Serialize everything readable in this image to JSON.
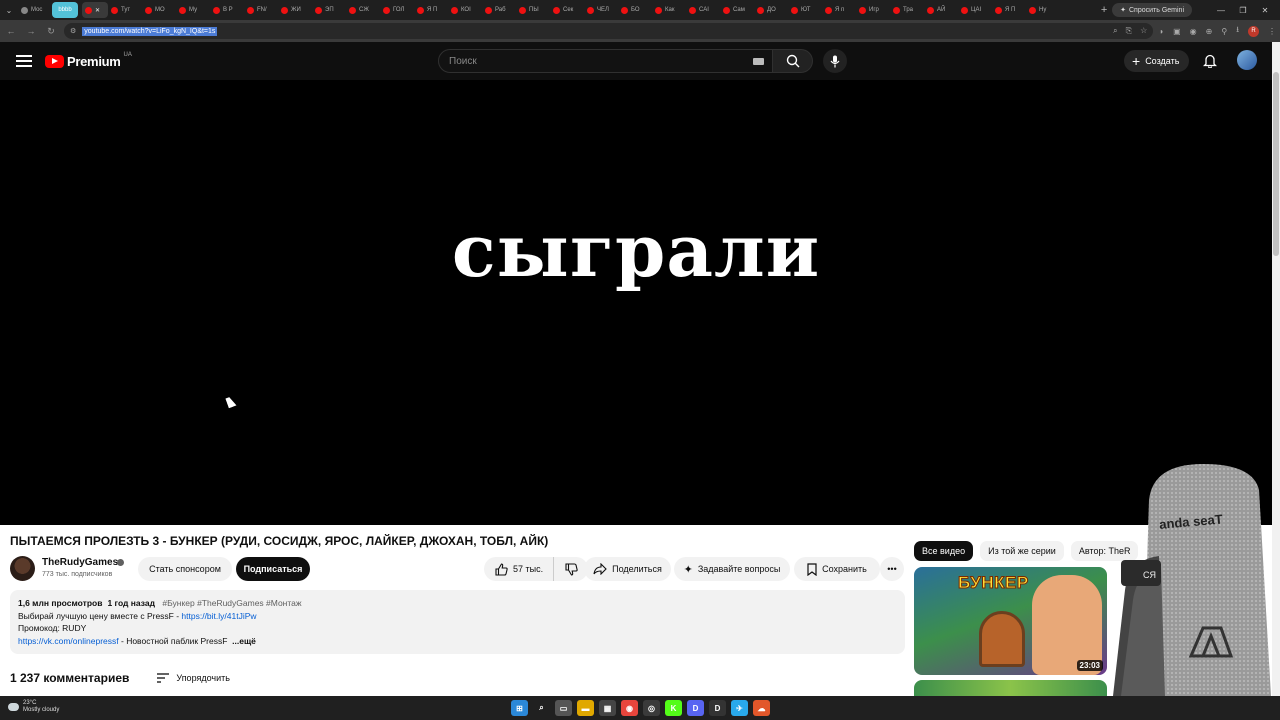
{
  "browser": {
    "tab_menu_icon": "chevron-down-icon",
    "tabs": [
      {
        "label": "Мос",
        "fav": "g"
      },
      {
        "label": "bbbb",
        "style": "hl"
      },
      {
        "label": "",
        "style": "active"
      },
      {
        "label": "Тут",
        "fav": "r"
      },
      {
        "label": "МО",
        "fav": "r"
      },
      {
        "label": "Му",
        "fav": "r"
      },
      {
        "label": "В Р",
        "fav": "r"
      },
      {
        "label": "FN/",
        "fav": "r"
      },
      {
        "label": "ЖИ",
        "fav": "r"
      },
      {
        "label": "ЭП",
        "fav": "r"
      },
      {
        "label": "СЖ",
        "fav": "r"
      },
      {
        "label": "ГОЛ",
        "fav": "r"
      },
      {
        "label": "Я П",
        "fav": "r"
      },
      {
        "label": "КОІ",
        "fav": "r"
      },
      {
        "label": "Раб",
        "fav": "r"
      },
      {
        "label": "ПЫ",
        "fav": "r"
      },
      {
        "label": "Сек",
        "fav": "r"
      },
      {
        "label": "ЧЕЛ",
        "fav": "r"
      },
      {
        "label": "БО",
        "fav": "r"
      },
      {
        "label": "Как",
        "fav": "r"
      },
      {
        "label": "САІ",
        "fav": "r"
      },
      {
        "label": "Сам",
        "fav": "r"
      },
      {
        "label": "ДО",
        "fav": "r"
      },
      {
        "label": "ЮТ",
        "fav": "r"
      },
      {
        "label": "Я п",
        "fav": "r"
      },
      {
        "label": "Игр",
        "fav": "r"
      },
      {
        "label": "Тра",
        "fav": "r"
      },
      {
        "label": "АЙ",
        "fav": "r"
      },
      {
        "label": "ЦАІ",
        "fav": "r"
      },
      {
        "label": "Я П",
        "fav": "r"
      },
      {
        "label": "Ну",
        "fav": "r"
      }
    ],
    "new_tab": "+",
    "gemini_label": "Спросить Gemini",
    "url": "youtube.com/watch?v=LiFo_kgN_IQ&t=1s",
    "profile_letter": "R"
  },
  "youtube": {
    "logo_text": "Premium",
    "country_code": "UA",
    "search_placeholder": "Поиск",
    "create_label": "Создать"
  },
  "player": {
    "caption": "сыграли"
  },
  "video": {
    "title": "ПЫТАЕМСЯ ПРОЛЕЗТЬ 3 - БУНКЕР (РУДИ, СОСИДЖ, ЯРОС, ЛАЙКЕР, ДЖОХАН, ТОБЛ, АЙК)",
    "channel_name": "TheRudyGames",
    "subscribers": "773 тыс. подписчиков",
    "sponsor_label": "Стать спонсором",
    "subscribe_label": "Подписаться",
    "likes": "57 тыс.",
    "share_label": "Поделиться",
    "ask_label": "Задавайте вопросы",
    "save_label": "Сохранить"
  },
  "description": {
    "views": "1,6 млн просмотров",
    "age": "1 год назад",
    "tags": "#Бункер #TheRudyGames #Монтаж",
    "line1_text": "Выбирай лучшую цену вместе с PressF - ",
    "line1_link": "https://bit.ly/41tJiPw",
    "line2": "Промокод: RUDY",
    "line3_link": "https://vk.com/onlinepressf",
    "line3_text": " - Новостной паблик PressF",
    "more": "...ещё"
  },
  "comments": {
    "count": "1 237 комментариев",
    "sort_label": "Упорядочить"
  },
  "sidebar": {
    "chips": [
      "Все видео",
      "Из той же серии",
      "Автор: TheR"
    ],
    "thumb1_word": "БУНКЕР",
    "thumb1_duration": "23:03"
  },
  "overlay": {
    "chair_brand": "anda seaT",
    "chair_fragment": "СЯ"
  },
  "taskbar": {
    "temp": "23°C",
    "weather": "Mostly cloudy",
    "icons": [
      {
        "name": "windows-start-icon",
        "color": "#2b88d8",
        "glyph": "⊞"
      },
      {
        "name": "search-icon",
        "color": "transparent",
        "glyph": "⌕"
      },
      {
        "name": "task-view-icon",
        "color": "#555",
        "glyph": "▭"
      },
      {
        "name": "file-explorer-icon",
        "color": "#e0a800",
        "glyph": "▬"
      },
      {
        "name": "store-icon",
        "color": "#444",
        "glyph": "▦"
      },
      {
        "name": "chrome-icon",
        "color": "#e8453c",
        "glyph": "◉"
      },
      {
        "name": "app-icon",
        "color": "#3a3a3a",
        "glyph": "◎"
      },
      {
        "name": "kick-icon",
        "color": "#53fc18",
        "glyph": "K"
      },
      {
        "name": "discord-icon",
        "color": "#5865f2",
        "glyph": "D"
      },
      {
        "name": "davinci-icon",
        "color": "#333",
        "glyph": "D"
      },
      {
        "name": "telegram-icon",
        "color": "#29a9eb",
        "glyph": "✈"
      },
      {
        "name": "cloud-app-icon",
        "color": "#e2572a",
        "glyph": "☁"
      }
    ]
  }
}
